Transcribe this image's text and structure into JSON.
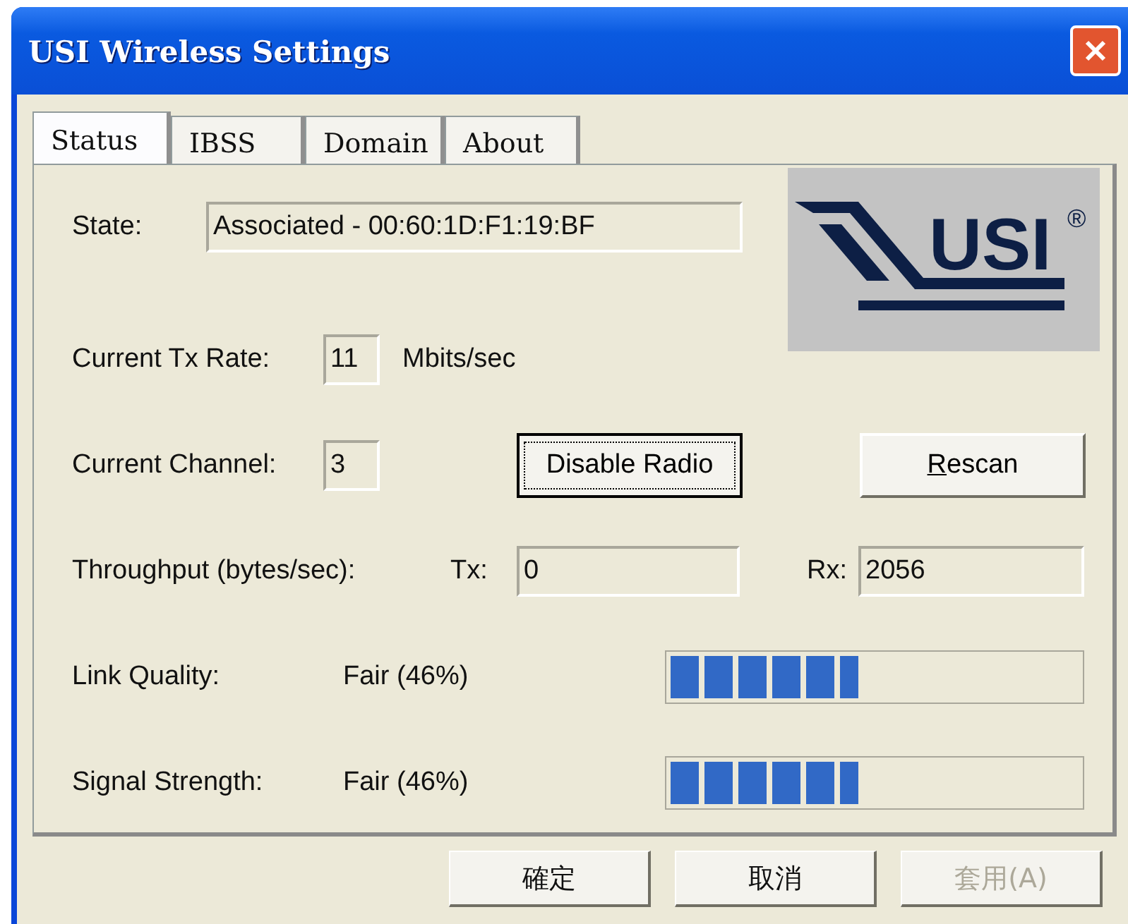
{
  "window": {
    "title": "USI Wireless Settings"
  },
  "tabs": [
    {
      "label": "Status",
      "selected": true
    },
    {
      "label": "IBSS",
      "selected": false
    },
    {
      "label": "Domain",
      "selected": false
    },
    {
      "label": "About",
      "selected": false
    }
  ],
  "logo": {
    "text": "USI",
    "mark": "®"
  },
  "state": {
    "label": "State:",
    "value": "Associated - 00:60:1D:F1:19:BF"
  },
  "tx_rate": {
    "label": "Current Tx Rate:",
    "value": "11",
    "unit": "Mbits/sec"
  },
  "channel": {
    "label": "Current Channel:",
    "value": "3"
  },
  "actions": [
    {
      "label": "Disable Radio",
      "focused": true,
      "accel_underlined": false
    },
    {
      "label": "Rescan",
      "focused": false,
      "accel_underlined": true
    }
  ],
  "throughput": {
    "label": "Throughput (bytes/sec):",
    "tx_label": "Tx:",
    "tx_value": "0",
    "rx_label": "Rx:",
    "rx_value": "2056"
  },
  "meters": [
    {
      "label": "Link Quality:",
      "reading": "Fair (46%)",
      "level": 0.46
    },
    {
      "label": "Signal Strength:",
      "reading": "Fair (46%)",
      "level": 0.46
    }
  ],
  "buttons": [
    {
      "label": "確定",
      "disabled": false
    },
    {
      "label": "取消",
      "disabled": false
    },
    {
      "label": "套用(A)",
      "disabled": true
    }
  ]
}
